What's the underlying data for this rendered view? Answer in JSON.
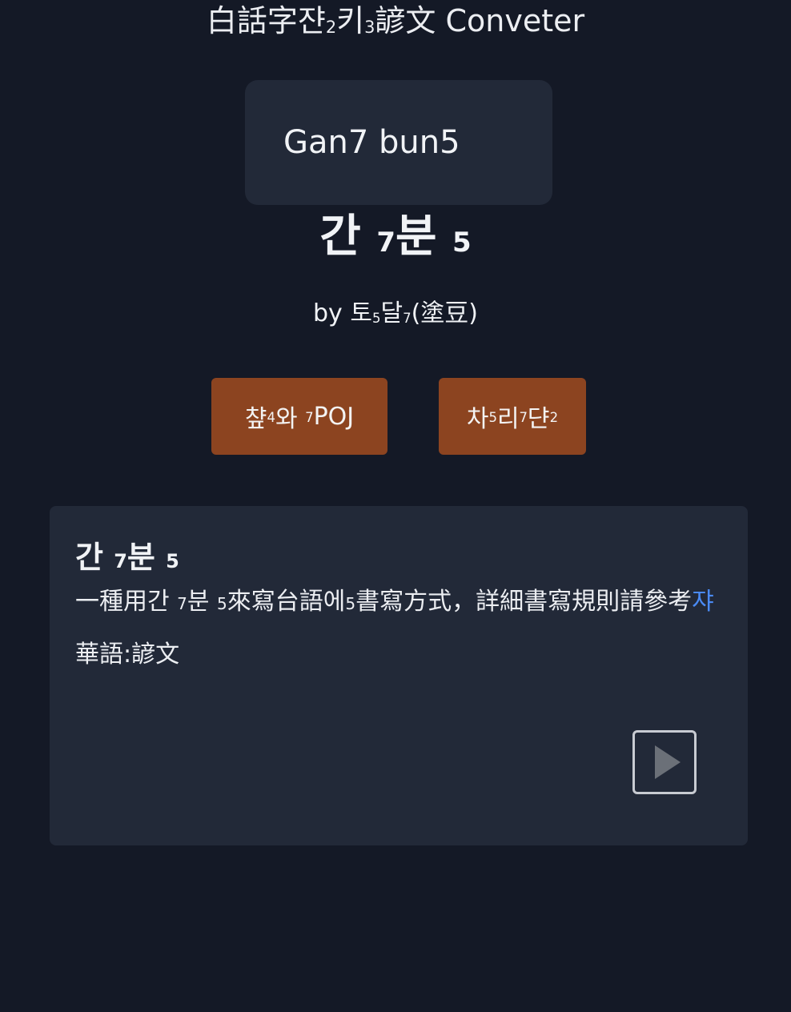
{
  "header": {
    "title_prefix": "白話字",
    "title_syl1": "쟌",
    "title_tone1": "2",
    "title_syl2": "키",
    "title_tone2": "3",
    "title_suffix": "諺文 Conveter"
  },
  "input": {
    "value": "Gan7 bun5"
  },
  "result": {
    "syl1": "간",
    "tone1": "7",
    "syl2": "분",
    "tone2": "5"
  },
  "byline": {
    "prefix": "by ",
    "syl1": "토",
    "tone1": "5",
    "syl2": "달",
    "tone2": "7",
    "suffix": "(塗豆)"
  },
  "buttons": {
    "poj": {
      "syl1": "챺",
      "tone1": "4",
      "syl2": "와",
      "tone2": "7",
      "suffix": "POJ"
    },
    "dictionary": {
      "syl1": "차",
      "tone1": "5",
      "syl2": "리",
      "tone2": "7",
      "syl3": "댠",
      "tone3": "2"
    }
  },
  "card": {
    "title_syl1": "간",
    "title_tone1": "7",
    "title_syl2": "분",
    "title_tone2": "5",
    "desc_prefix": "一種用",
    "desc_syl1": "간",
    "desc_tone1": "7",
    "desc_syl2": "분",
    "desc_tone2": "5",
    "desc_mid": "來寫台語",
    "desc_syl3": "에",
    "desc_tone3": "5",
    "desc_suffix": "書寫方式，詳細書寫規則請參考",
    "link_text": "쟈",
    "mandarin": "華語:諺文"
  },
  "colors": {
    "background": "#141926",
    "panel": "#222938",
    "button": "#8c4420",
    "link": "#4a8af4"
  },
  "icons": {
    "play": "play-icon"
  }
}
